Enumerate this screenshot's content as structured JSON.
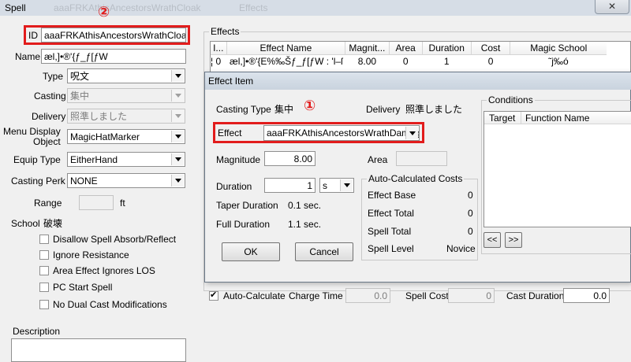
{
  "window": {
    "title": "Spell",
    "bg_title_1": "aaaFRKAthisAncestorsWrathCloak",
    "bg_title_2": "Effects",
    "close_glyph": "✕"
  },
  "annotations": {
    "one": "①",
    "two": "②"
  },
  "spell": {
    "id_label": "ID",
    "id_value": "aaaFRKAthisAncestorsWrathCloakDm",
    "name_label": "Name",
    "name_value": "æl,]•®'{ƒ_ƒ[ƒW",
    "type_label": "Type",
    "type_value": "呪文",
    "casting_label": "Casting",
    "casting_value": "集中",
    "delivery_label": "Delivery",
    "delivery_value": "照準しました",
    "menu_display_label_1": "Menu Display",
    "menu_display_label_2": "Object",
    "menu_display_value": "MagicHatMarker",
    "equip_type_label": "Equip Type",
    "equip_type_value": "EitherHand",
    "casting_perk_label": "Casting Perk",
    "casting_perk_value": "NONE",
    "range_label": "Range",
    "range_value": "",
    "range_unit": "ft",
    "school_label": "School",
    "school_value": "破壊",
    "checkboxes": [
      {
        "label": "Disallow Spell Absorb/Reflect",
        "checked": false
      },
      {
        "label": "Ignore Resistance",
        "checked": false
      },
      {
        "label": "Area Effect Ignores LOS",
        "checked": false
      },
      {
        "label": "PC Start Spell",
        "checked": false
      },
      {
        "label": "No Dual Cast Modifications",
        "checked": false
      }
    ],
    "description_label": "Description"
  },
  "effects": {
    "group_label": "Effects",
    "columns": [
      "I...",
      "Effect Name",
      "Magnit...",
      "Area",
      "Duration",
      "Cost",
      "Magic School"
    ],
    "rows": [
      {
        "icon": "¦",
        "index": "0",
        "name": "æl,]•®'{E%‰Šƒ_ƒ[ƒW : 'l–ſ",
        "magnitude": "8.00",
        "area": "0",
        "duration": "1",
        "cost": "0",
        "school": "˜j‰ó"
      }
    ],
    "auto_calculate_label": "Auto-Calculate",
    "auto_calculate_checked": true,
    "charge_time_label": "Charge Time",
    "charge_time_value": "0.0",
    "spell_cost_label": "Spell Cost",
    "spell_cost_value": "0",
    "cast_duration_label": "Cast Duration",
    "cast_duration_value": "0.0"
  },
  "effect_item": {
    "title": "Effect Item",
    "casting_type_label": "Casting Type",
    "casting_type_value": "集中",
    "delivery_label": "Delivery",
    "delivery_value": "照準しました",
    "effect_label": "Effect",
    "effect_value": "aaaFRKAthisAncestorsWrathDamage",
    "magnitude_label": "Magnitude",
    "magnitude_value": "8.00",
    "area_label": "Area",
    "area_value": "",
    "duration_label": "Duration",
    "duration_value": "1",
    "duration_unit": "s",
    "taper_duration_label": "Taper Duration",
    "taper_duration_value": "0.1 sec.",
    "full_duration_label": "Full Duration",
    "full_duration_value": "1.1 sec.",
    "ok_label": "OK",
    "cancel_label": "Cancel",
    "auto_costs": {
      "group_label": "Auto-Calculated Costs",
      "effect_base_label": "Effect Base",
      "effect_base_value": "0",
      "effect_total_label": "Effect Total",
      "effect_total_value": "0",
      "spell_total_label": "Spell Total",
      "spell_total_value": "0",
      "spell_level_label": "Spell Level",
      "spell_level_value": "Novice"
    },
    "conditions": {
      "group_label": "Conditions",
      "columns": [
        "Target",
        "Function Name"
      ],
      "prev_label": "<<",
      "next_label": ">>"
    }
  }
}
